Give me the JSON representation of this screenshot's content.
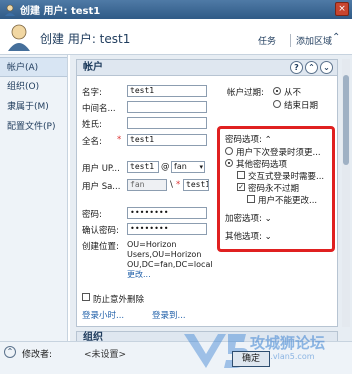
{
  "window": {
    "title": "创建 用户: test1",
    "close": "×"
  },
  "header": {
    "page_title": "创建 用户: test1",
    "tasks": "任务",
    "add_section": "添加区域"
  },
  "sidebar": {
    "items": [
      {
        "label": "帐户(A)"
      },
      {
        "label": "组织(O)"
      },
      {
        "label": "隶属于(M)"
      },
      {
        "label": "配置文件(P)"
      }
    ]
  },
  "account": {
    "section_title": "帐户",
    "labels": {
      "first_name": "名字:",
      "middle_initial": "中间名...",
      "last_name": "姓氏:",
      "full_name": "全名:",
      "upn": "用户 UP...",
      "sam": "用户 Sa...",
      "password": "密码:",
      "confirm_password": "确认密码:",
      "create_in": "创建位置:"
    },
    "values": {
      "first_name": "test1",
      "middle_initial": "",
      "last_name": "",
      "full_name": "test1",
      "upn_prefix": "test1",
      "upn_domain": "fan",
      "sam_domain": "fan",
      "sam_name": "test1",
      "password": "••••••••",
      "confirm_password": "••••••••"
    },
    "create_in_value": "OU=Horizon Users,OU=Horizon OU,DC=fan,DC=local",
    "change_link": "更改...",
    "protect_label": "防止意外删除",
    "logon_hours_link": "登录小时...",
    "logon_to_link": "登录到...",
    "expiration_label": "帐户过期:",
    "never": "从不",
    "end_of": "结束日期",
    "password_options": "密码选项:",
    "must_change": "用户下次登录时须更...",
    "other_options": "其他密码选项",
    "interactive": "交互式登录时需要...",
    "never_expires": "密码永不过期",
    "cannot_change": "用户不能更改...",
    "encryption_options": "加密选项:",
    "other_options2": "其他选项:"
  },
  "next_section": "组织",
  "footer": {
    "modified_by_label": "修改者:",
    "modified_by_value": "<未设置>",
    "ok": "确定",
    "watermark": "攻城狮论坛",
    "watermark_url": "bbs.vlan5.com"
  },
  "colors": {
    "highlight": "#e02020",
    "accent": "#1e3b5c",
    "link": "#1f5fa8"
  }
}
